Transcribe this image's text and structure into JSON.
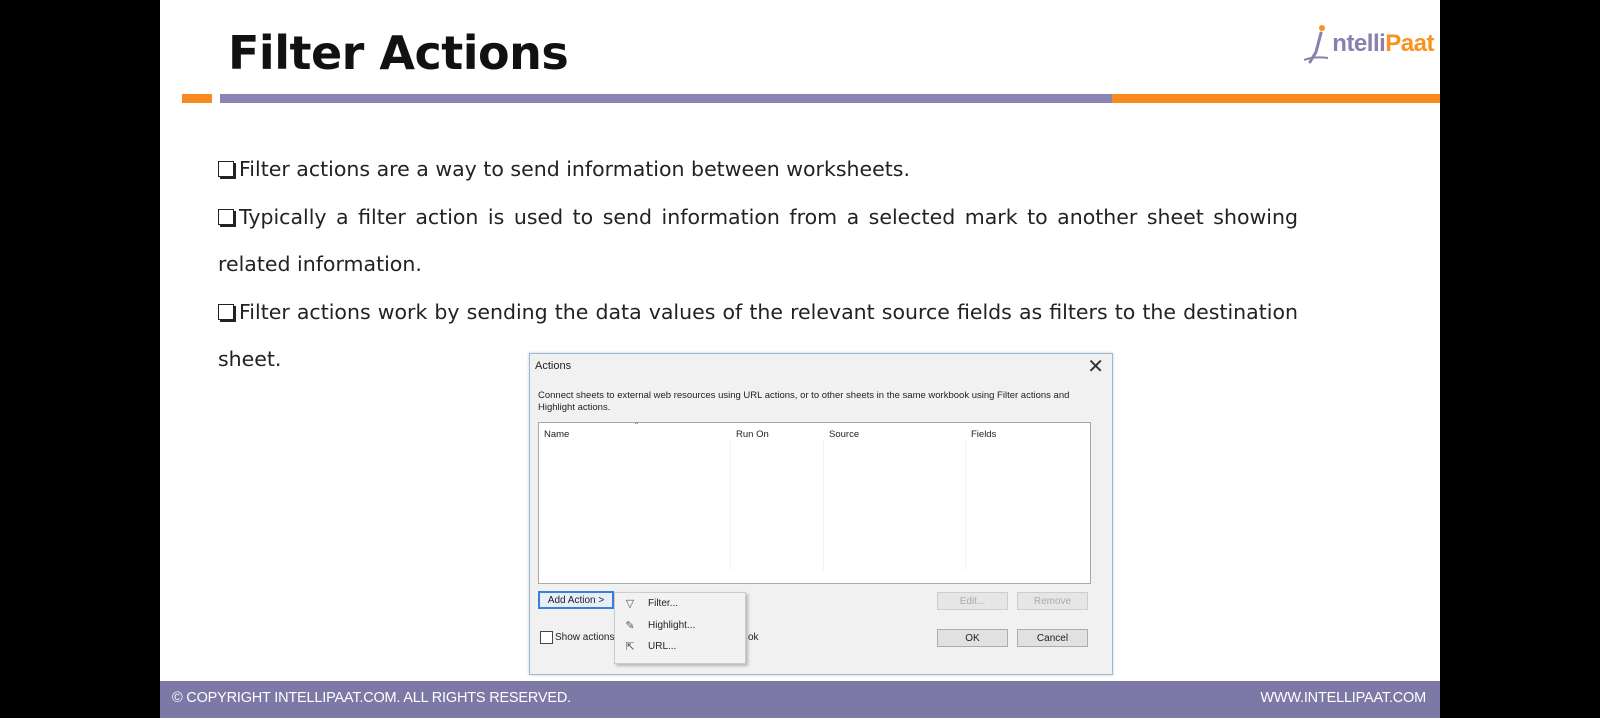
{
  "slide": {
    "title": "Filter Actions",
    "logo": {
      "lead": "ntelli",
      "accent": "Paat"
    },
    "bullets": [
      "Filter actions are a way to send information between worksheets.",
      "Typically a filter action is used to send information from a selected mark to another sheet showing related information.",
      "Filter actions work by sending the data values of the relevant source fields as filters to the destination sheet."
    ]
  },
  "dialog": {
    "title": "Actions",
    "close": "✕",
    "description": "Connect sheets to external web resources using URL actions, or to other sheets in the same workbook using Filter actions and Highlight actions.",
    "columns": [
      "Name",
      "Run On",
      "Source",
      "Fields"
    ],
    "add_action": "Add Action >",
    "edit": "Edit...",
    "remove": "Remove",
    "show_actions": "Show actions",
    "show_actions_tail": "ok",
    "ok": "OK",
    "cancel": "Cancel",
    "menu": [
      {
        "icon": "filter-icon",
        "label": "Filter..."
      },
      {
        "icon": "highlight-icon",
        "label": "Highlight..."
      },
      {
        "icon": "url-icon",
        "label": "URL..."
      }
    ]
  },
  "footer": {
    "copyright": "© COPYRIGHT  INTELLIPAAT.COM. ALL RIGHTS RESERVED.",
    "website": "WWW.INTELLIPAAT.COM"
  },
  "colors": {
    "orange": "#f7891f",
    "purple": "#8a84b2",
    "footer": "#7d78a6"
  }
}
